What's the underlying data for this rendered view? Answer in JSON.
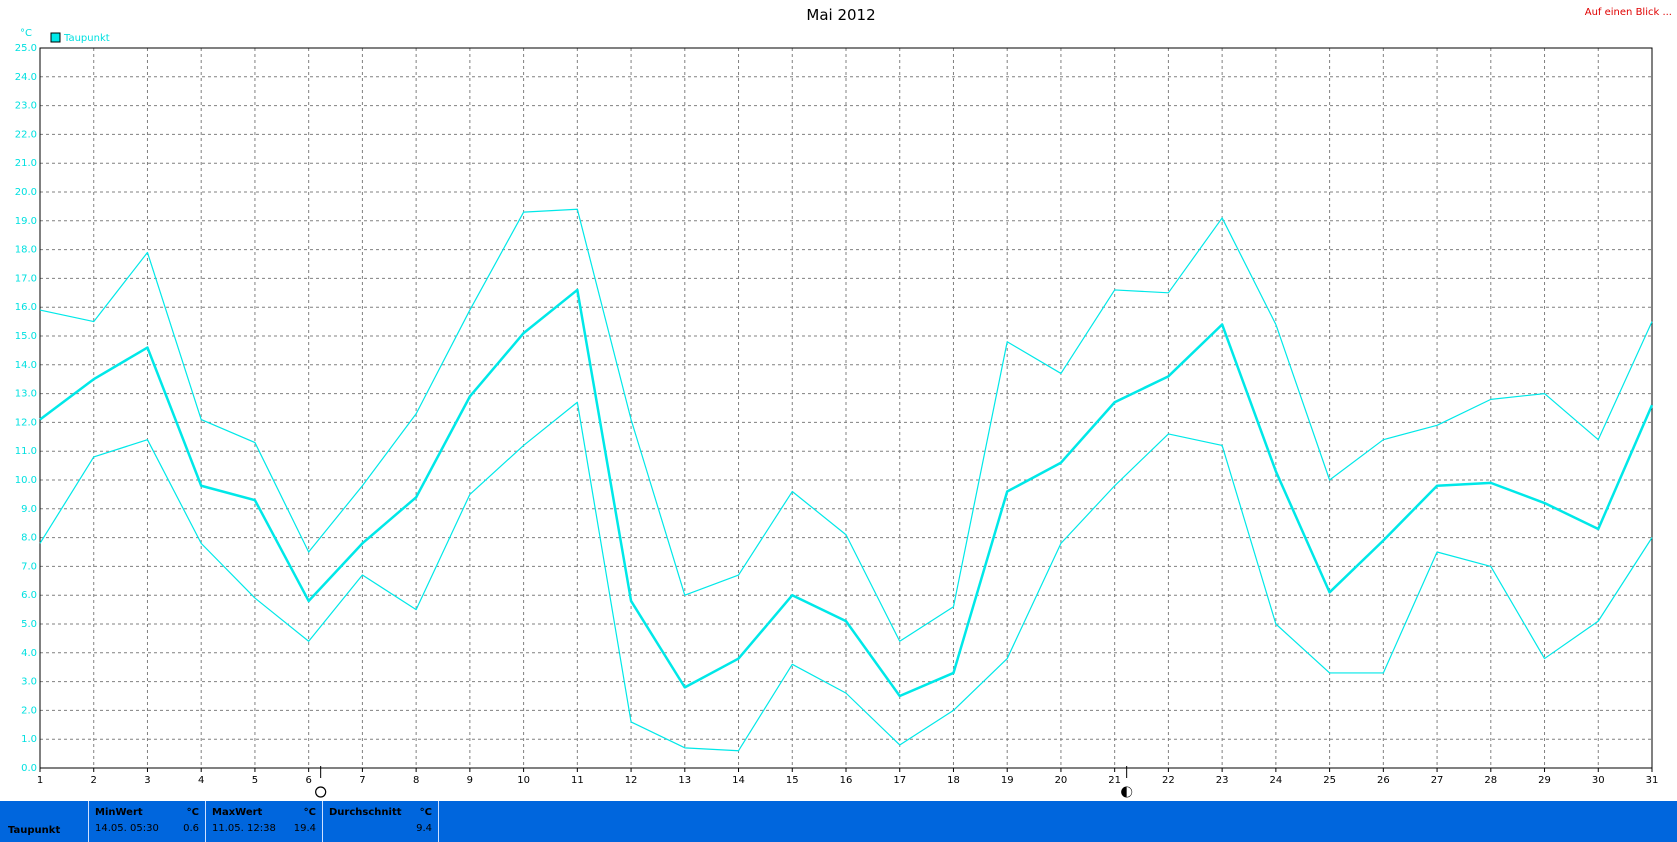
{
  "header": {
    "link_text": "Auf einen Blick ..."
  },
  "colors": {
    "series": "#00e8e8",
    "grid": "#808080",
    "link": "#e00000",
    "stats_bar": "#0066dd"
  },
  "chart_data": {
    "type": "line",
    "title": "Mai 2012",
    "ylabel": "°C",
    "xlabel": "",
    "ylim": [
      0,
      25
    ],
    "y_ticks": [
      "0.0",
      "1.0",
      "2.0",
      "3.0",
      "4.0",
      "5.0",
      "6.0",
      "7.0",
      "8.0",
      "9.0",
      "10.0",
      "11.0",
      "12.0",
      "13.0",
      "14.0",
      "15.0",
      "16.0",
      "17.0",
      "18.0",
      "19.0",
      "20.0",
      "21.0",
      "22.0",
      "23.0",
      "24.0",
      "25.0"
    ],
    "x": [
      1,
      2,
      3,
      4,
      5,
      6,
      7,
      8,
      9,
      10,
      11,
      12,
      13,
      14,
      15,
      16,
      17,
      18,
      19,
      20,
      21,
      22,
      23,
      24,
      25,
      26,
      27,
      28,
      29,
      30,
      31
    ],
    "grid": true,
    "legend": {
      "position": "top-left",
      "entries": [
        "Taupunkt"
      ]
    },
    "series": [
      {
        "name": "Taupunkt",
        "role": "mean",
        "values": [
          12.1,
          13.5,
          14.6,
          9.8,
          9.3,
          5.8,
          7.8,
          9.4,
          12.9,
          15.1,
          16.6,
          5.8,
          2.8,
          3.8,
          6.0,
          5.1,
          2.5,
          3.3,
          9.6,
          10.6,
          12.7,
          13.6,
          15.4,
          10.3,
          6.1,
          7.9,
          9.8,
          9.9,
          9.2,
          8.3,
          12.6
        ]
      },
      {
        "role": "max",
        "values": [
          15.9,
          15.5,
          17.9,
          12.1,
          11.3,
          7.5,
          9.8,
          12.3,
          15.9,
          19.3,
          19.4,
          12.1,
          6.0,
          6.7,
          9.6,
          8.1,
          4.4,
          5.6,
          14.8,
          13.7,
          16.6,
          16.5,
          19.1,
          15.4,
          10.0,
          11.4,
          11.9,
          12.8,
          13.0,
          11.4,
          15.5
        ]
      },
      {
        "role": "min",
        "values": [
          7.8,
          10.8,
          11.4,
          7.8,
          5.9,
          4.4,
          6.7,
          5.5,
          9.5,
          11.2,
          12.7,
          1.6,
          0.7,
          0.6,
          3.6,
          2.6,
          0.8,
          2.0,
          3.8,
          7.8,
          9.8,
          11.6,
          11.2,
          5.0,
          3.3,
          3.3,
          7.5,
          7.0,
          3.8,
          5.1,
          8.0
        ]
      }
    ],
    "moon_phases": [
      {
        "day": 6,
        "phase": "full-moon"
      },
      {
        "day": 21,
        "phase": "new-moon"
      }
    ]
  },
  "stats": {
    "row_label": "Taupunkt",
    "columns": [
      {
        "header": "MinWert",
        "unit": "°C",
        "time": "14.05.  05:30",
        "value": "0.6"
      },
      {
        "header": "MaxWert",
        "unit": "°C",
        "time": "11.05.  12:38",
        "value": "19.4"
      },
      {
        "header": "Durchschnitt",
        "unit": "°C",
        "time": "",
        "value": "9.4"
      }
    ]
  }
}
